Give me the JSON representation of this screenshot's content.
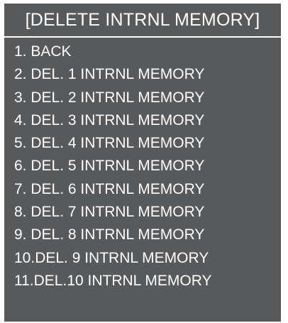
{
  "menu": {
    "title": "[DELETE INTRNL MEMORY]",
    "items": [
      {
        "label": "1.  BACK"
      },
      {
        "label": "2.  DEL. 1 INTRNL MEMORY"
      },
      {
        "label": "3.  DEL. 2 INTRNL MEMORY"
      },
      {
        "label": "4.  DEL. 3 INTRNL MEMORY"
      },
      {
        "label": "5.  DEL. 4 INTRNL MEMORY"
      },
      {
        "label": "6.  DEL. 5 INTRNL MEMORY"
      },
      {
        "label": "7.  DEL. 6 INTRNL MEMORY"
      },
      {
        "label": "8.  DEL. 7 INTRNL MEMORY"
      },
      {
        "label": "9.  DEL. 8 INTRNL MEMORY"
      },
      {
        "label": "10.DEL. 9 INTRNL MEMORY"
      },
      {
        "label": "11.DEL.10 INTRNL MEMORY"
      }
    ]
  },
  "colors": {
    "panel_background": "#58595b",
    "text": "#ffffff",
    "divider": "#ffffff"
  }
}
